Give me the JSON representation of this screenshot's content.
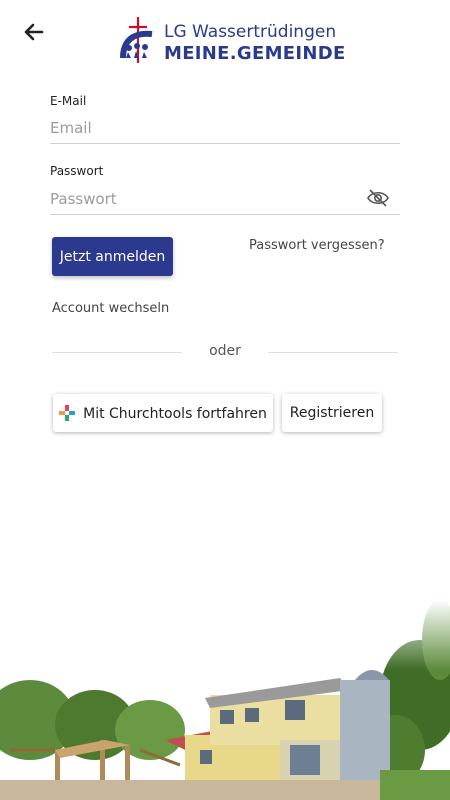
{
  "header": {
    "back_icon": "arrow-left-icon",
    "logo_line1": "LG Wassertrüdingen",
    "logo_line2": "MEINE.GEMEINDE",
    "brand_color": "#2b3a8f"
  },
  "form": {
    "email_label": "E-Mail",
    "email_placeholder": "Email",
    "password_label": "Passwort",
    "password_placeholder": "Passwort",
    "eye_icon": "eye-off-icon",
    "login_button": "Jetzt anmelden",
    "forgot_password": "Passwort vergessen?",
    "switch_account": "Account wechseln",
    "divider_text": "oder",
    "churchtools_button": "Mit Churchtools fortfahren",
    "register_button": "Registrieren"
  },
  "footer": {
    "image": "church-building-photo"
  }
}
